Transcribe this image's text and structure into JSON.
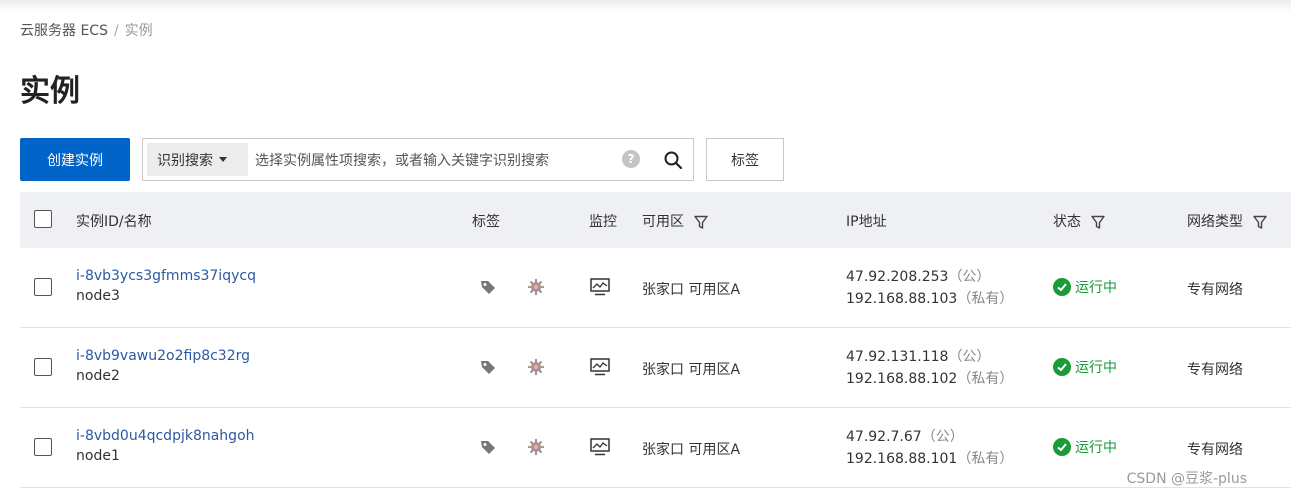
{
  "breadcrumb": {
    "parent": "云服务器 ECS",
    "separator": "/",
    "current": "实例"
  },
  "page": {
    "title": "实例"
  },
  "toolbar": {
    "create_label": "创建实例",
    "search_select": "识别搜索",
    "search_placeholder": "选择实例属性项搜索，或者输入关键字识别搜索",
    "help": "?",
    "tags_label": "标签"
  },
  "table": {
    "headers": {
      "id_name": "实例ID/名称",
      "tags": "标签",
      "monitor": "监控",
      "zone": "可用区",
      "ip": "IP地址",
      "status": "状态",
      "network": "网络类型"
    },
    "rows": [
      {
        "id": "i-8vb3ycs3gfmms37iqycq",
        "name": "node3",
        "zone": "张家口 可用区A",
        "public_ip": "47.92.208.253",
        "public_label": "（公）",
        "private_ip": "192.168.88.103",
        "private_label": "（私有）",
        "status": "运行中",
        "network": "专有网络"
      },
      {
        "id": "i-8vb9vawu2o2fip8c32rg",
        "name": "node2",
        "zone": "张家口 可用区A",
        "public_ip": "47.92.131.118",
        "public_label": "（公）",
        "private_ip": "192.168.88.102",
        "private_label": "（私有）",
        "status": "运行中",
        "network": "专有网络"
      },
      {
        "id": "i-8vbd0u4qcdpjk8nahgoh",
        "name": "node1",
        "zone": "张家口 可用区A",
        "public_ip": "47.92.7.67",
        "public_label": "（公）",
        "private_ip": "192.168.88.101",
        "private_label": "（私有）",
        "status": "运行中",
        "network": "专有网络"
      }
    ]
  },
  "watermark": "CSDN @豆浆-plus",
  "colors": {
    "primary": "#0064c8",
    "link": "#2b5aa4",
    "running": "#1a9b3a",
    "header_bg": "#eef0f4"
  },
  "icons": [
    "search-icon",
    "help-icon",
    "filter-icon",
    "tag-icon",
    "settings-icon",
    "monitor-icon",
    "check-circle-icon",
    "dropdown-caret-icon"
  ]
}
